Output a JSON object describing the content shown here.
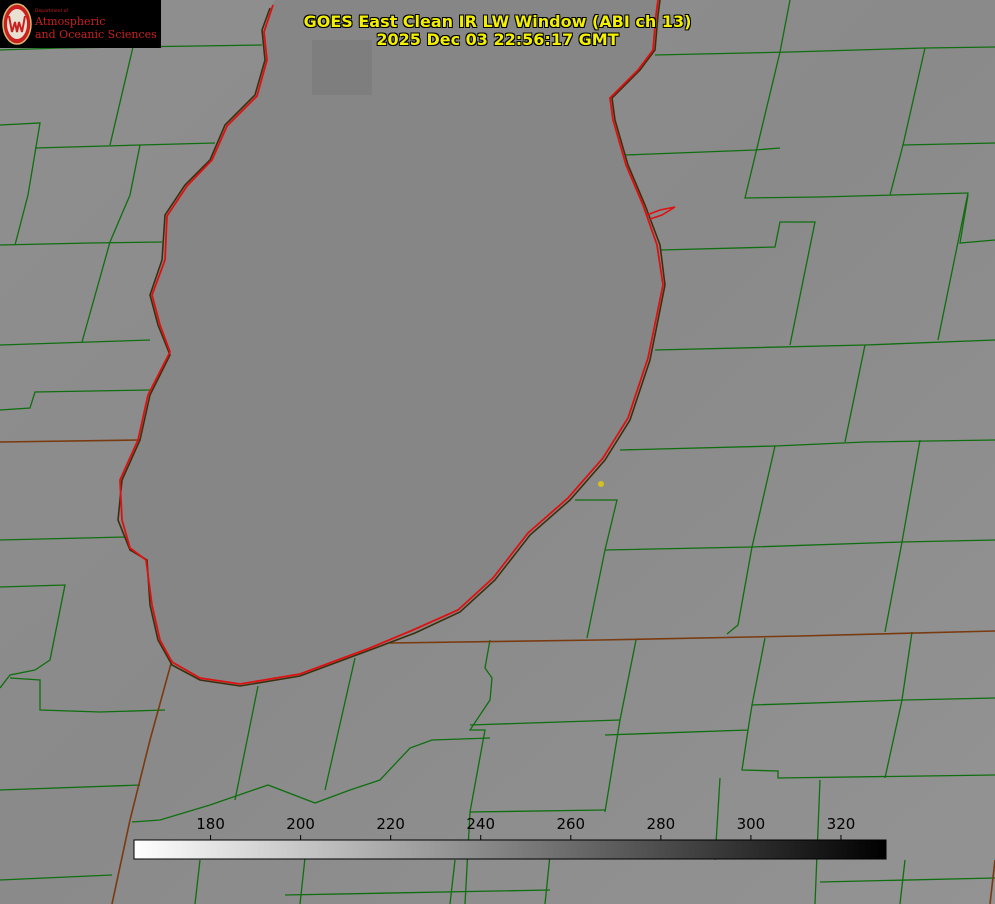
{
  "header": {
    "title_line1": "GOES East Clean IR LW Window (ABI ch 13)",
    "title_line2": "2025 Dec 03 22:56:17 GMT"
  },
  "logo": {
    "dept_label": "Department of",
    "line1": "Atmospheric",
    "line2": "and Oceanic Sciences"
  },
  "colorbar": {
    "ticks": [
      "180",
      "200",
      "220",
      "240",
      "260",
      "280",
      "300",
      "320"
    ],
    "value_min": 163,
    "value_max": 330
  },
  "colors": {
    "lake_outline": "#e01010",
    "county_lines": "#0f6e0f",
    "state_lines": "#8a4a1a",
    "title_text": "#f2f000",
    "marker": "#d4c020",
    "logo_red": "#c9201f"
  }
}
